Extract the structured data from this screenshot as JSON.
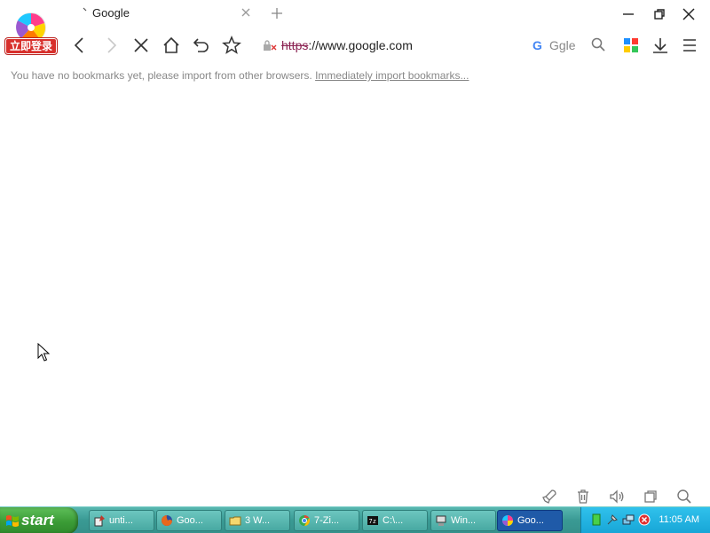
{
  "browser": {
    "login_badge": "立即登录",
    "tab": {
      "title": "Google"
    },
    "address": {
      "scheme": "https",
      "rest": "://www.google.com"
    },
    "search": {
      "engine_icon": "G",
      "label": "Ggle"
    },
    "bookmark_bar": {
      "message": "You have no bookmarks yet, please import from other browsers.",
      "link": "Immediately import bookmarks..."
    }
  },
  "taskbar": {
    "start_label": "start",
    "tasks": [
      {
        "label": "unti..."
      },
      {
        "label": "Goo..."
      },
      {
        "label": "3 W..."
      },
      {
        "label": "7-Zi..."
      },
      {
        "label": "C:\\..."
      },
      {
        "label": "Win..."
      },
      {
        "label": "Goo..."
      }
    ],
    "clock": "11:05 AM"
  },
  "colors": {
    "taskbar": "#3a9a94",
    "start": "#3b9c36",
    "tray": "#17a5d6",
    "active_task": "#1f5aa8",
    "badge": "#d8302c"
  }
}
